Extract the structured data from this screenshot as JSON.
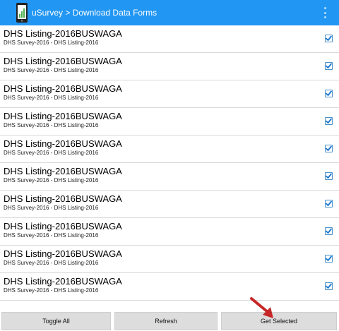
{
  "app_bar": {
    "title": "uSurvey > Download Data Forms",
    "color": "#2196f3",
    "app_icon": "phone-chart-icon",
    "overflow_icon": "overflow-menu-icon"
  },
  "forms": [
    {
      "title": "DHS Listing-2016BUSWAGA",
      "subtitle": "DHS Survey-2016 - DHS Listing-2016",
      "checked": true
    },
    {
      "title": "DHS Listing-2016BUSWAGA",
      "subtitle": "DHS Survey-2016 - DHS Listing-2016",
      "checked": true
    },
    {
      "title": "DHS Listing-2016BUSWAGA",
      "subtitle": "DHS Survey-2016 - DHS Listing-2016",
      "checked": true
    },
    {
      "title": "DHS Listing-2016BUSWAGA",
      "subtitle": "DHS Survey-2016 - DHS Listing-2016",
      "checked": true
    },
    {
      "title": "DHS Listing-2016BUSWAGA",
      "subtitle": "DHS Survey-2016 - DHS Listing-2016",
      "checked": true
    },
    {
      "title": "DHS Listing-2016BUSWAGA",
      "subtitle": "DHS Survey-2016 - DHS Listing-2016",
      "checked": true
    },
    {
      "title": "DHS Listing-2016BUSWAGA",
      "subtitle": "DHS Survey-2016 - DHS Listing-2016",
      "checked": true
    },
    {
      "title": "DHS Listing-2016BUSWAGA",
      "subtitle": "DHS Survey-2016 - DHS Listing-2016",
      "checked": true
    },
    {
      "title": "DHS Listing-2016BUSWAGA",
      "subtitle": "DHS Survey-2016 - DHS Listing-2016",
      "checked": true
    },
    {
      "title": "DHS Listing-2016BUSWAGA",
      "subtitle": "DHS Survey-2016 - DHS Listing-2016",
      "checked": true
    }
  ],
  "buttons": {
    "toggle_all": "Toggle All",
    "refresh": "Refresh",
    "get_selected": "Get Selected"
  },
  "annotation": {
    "icon": "red-arrow-icon",
    "color": "#c62828"
  },
  "checkbox_color": "#1976d2"
}
